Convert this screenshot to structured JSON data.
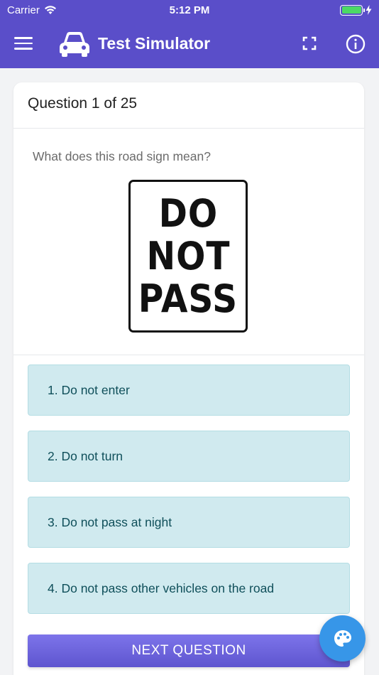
{
  "status_bar": {
    "carrier": "Carrier",
    "time": "5:12 PM",
    "battery_level": 1.0
  },
  "app_bar": {
    "title": "Test Simulator",
    "icons": [
      "menu-icon",
      "car-icon",
      "fullscreen-icon",
      "info-icon"
    ]
  },
  "question": {
    "header": "Question 1 of 25",
    "text": "What does this road sign mean?",
    "sign_lines": [
      "DO",
      "NOT",
      "PASS"
    ]
  },
  "answers": [
    {
      "label": "1. Do not enter"
    },
    {
      "label": "2. Do not turn"
    },
    {
      "label": "3. Do not pass at night"
    },
    {
      "label": "4. Do not pass other vehicles on the road"
    }
  ],
  "next_button": {
    "label": "NEXT QUESTION"
  },
  "fab": {
    "icon": "palette-icon"
  },
  "colors": {
    "app_bar": "#5a4ec9",
    "answer_bg": "#d0eaef",
    "answer_text": "#0f4f5a",
    "next_button": "#6f66e0",
    "fab": "#3796e8"
  }
}
